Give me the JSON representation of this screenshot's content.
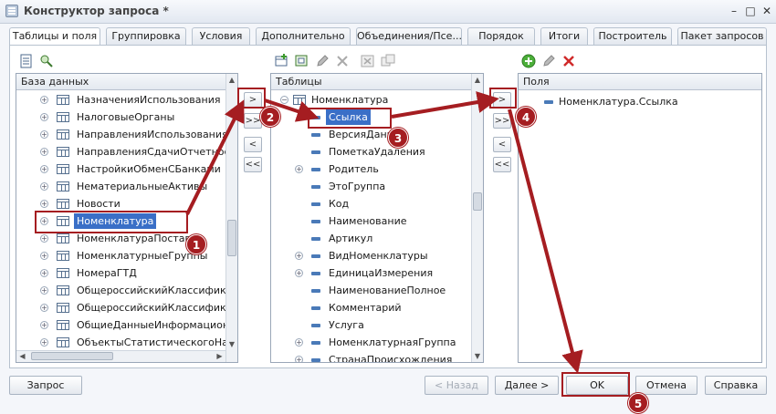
{
  "window": {
    "title": "Конструктор запроса *"
  },
  "tabs": [
    {
      "label": "Таблицы и поля",
      "active": true
    },
    {
      "label": "Группировка"
    },
    {
      "label": "Условия"
    },
    {
      "label": "Дополнительно"
    },
    {
      "label": "Объединения/Псе..."
    },
    {
      "label": "Порядок"
    },
    {
      "label": "Итоги"
    },
    {
      "label": "Построитель"
    },
    {
      "label": "Пакет запросов"
    }
  ],
  "database_panel": {
    "header": "База данных",
    "items": [
      "НазначенияИспользования",
      "НалоговыеОрганы",
      "НаправленияИспользованияПр",
      "НаправленияСдачиОтчетност",
      "НастройкиОбменСБанками",
      "НематериальныеАктивы",
      "Новости",
      "Номенклатура",
      "НоменклатураПоставщ",
      "НоменклатурныеГруппы",
      "НомераГТД",
      "ОбщероссийскийКлассификато",
      "ОбщероссийскийКлассификато",
      "ОбщиеДанныеИнформационно",
      "ОбъектыСтатистическогоНабл"
    ],
    "selected_index": 7
  },
  "tables_panel": {
    "header": "Таблицы",
    "root": "Номенклатура",
    "fields": [
      {
        "label": "Ссылка",
        "expandable": false
      },
      {
        "label": "ВерсияДанных",
        "expandable": false
      },
      {
        "label": "ПометкаУдаления",
        "expandable": false
      },
      {
        "label": "Родитель",
        "expandable": true
      },
      {
        "label": "ЭтоГруппа",
        "expandable": false
      },
      {
        "label": "Код",
        "expandable": false
      },
      {
        "label": "Наименование",
        "expandable": false
      },
      {
        "label": "Артикул",
        "expandable": false
      },
      {
        "label": "ВидНоменклатуры",
        "expandable": true
      },
      {
        "label": "ЕдиницаИзмерения",
        "expandable": true
      },
      {
        "label": "НаименованиеПолное",
        "expandable": false
      },
      {
        "label": "Комментарий",
        "expandable": false
      },
      {
        "label": "Услуга",
        "expandable": false
      },
      {
        "label": "НоменклатурнаяГруппа",
        "expandable": true
      },
      {
        "label": "СтранаПроисхождения",
        "expandable": true
      }
    ],
    "selected_index": 0
  },
  "fields_panel": {
    "header": "Поля",
    "items": [
      "Номенклатура.Ссылка"
    ]
  },
  "move_buttons": {
    "add_one": ">",
    "add_all": ">>",
    "remove_one": "<",
    "remove_all": "<<"
  },
  "bottom_buttons": {
    "query": "Запрос",
    "back": "< Назад",
    "next": "Далее >",
    "ok": "OK",
    "cancel": "Отмена",
    "help": "Справка"
  },
  "annotations": {
    "color": "#a51d21",
    "badges": [
      "1",
      "2",
      "3",
      "4",
      "5"
    ]
  }
}
